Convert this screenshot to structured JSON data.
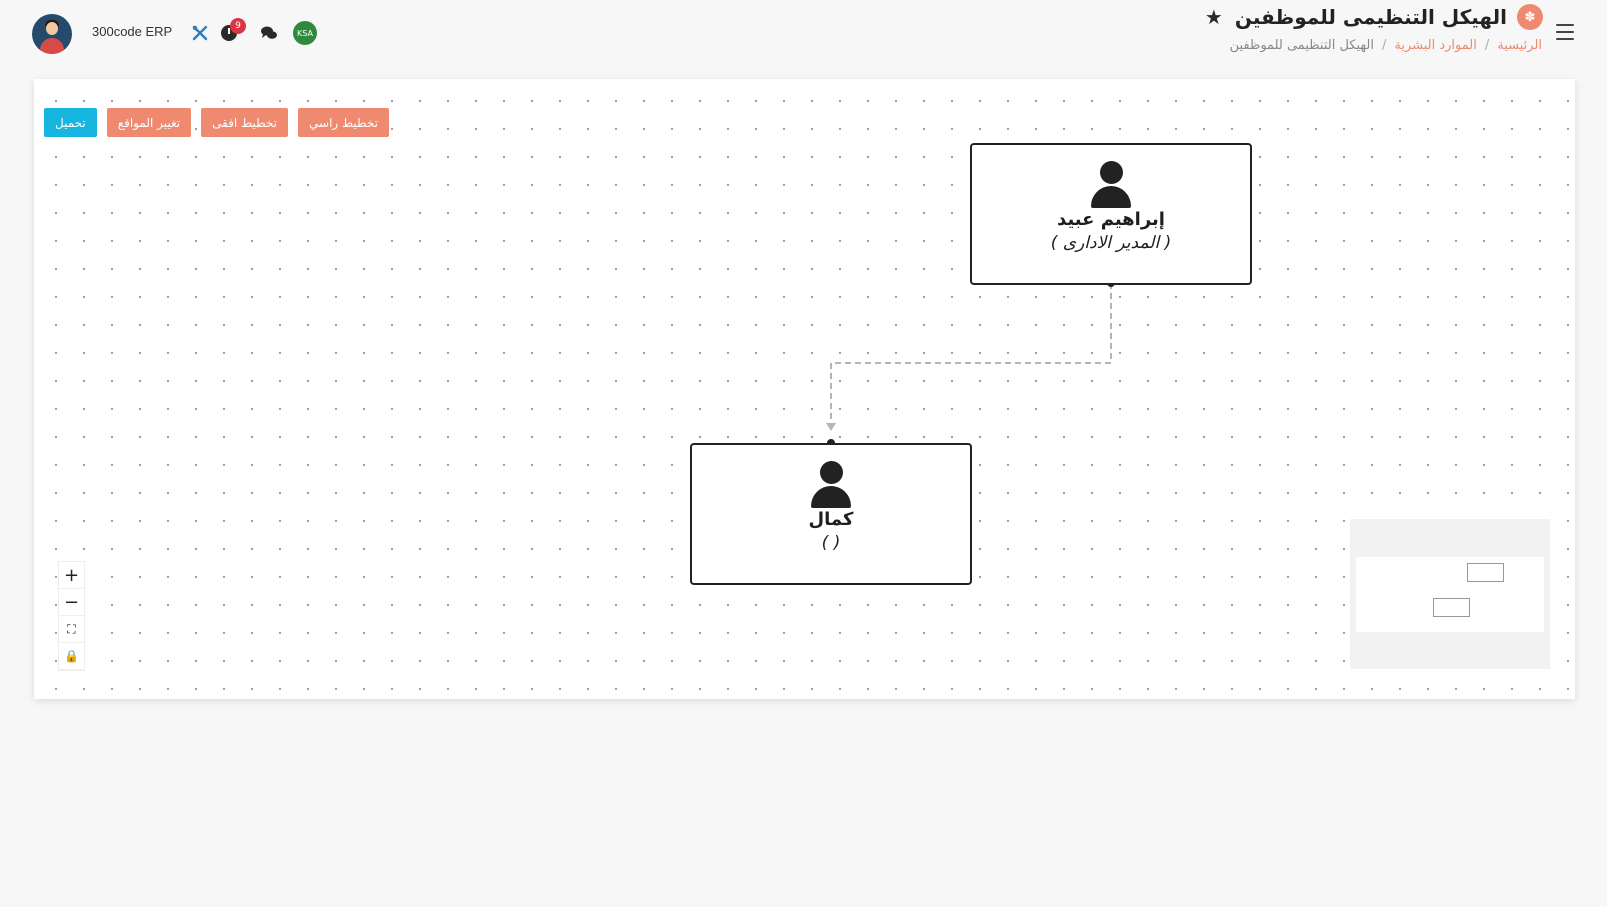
{
  "header": {
    "brand": "300code ERP",
    "notification_count": "9",
    "flag_label": "KSA",
    "page_title": "الهيكل التنظيمى للموظفين",
    "breadcrumb": {
      "home": "الرئيسية",
      "section": "الموارد البشرية",
      "current": "الهيكل التنظيمى للموظفين",
      "separator": "/"
    }
  },
  "toolbar": {
    "download_label": "تحميل",
    "change_positions_label": "تغيير المواقع",
    "horizontal_layout_label": "تخطيط افقى",
    "vertical_layout_label": "تخطيط راسي"
  },
  "nodes": [
    {
      "name": "إبراهيم عبيد",
      "role": "( المدير الادارى )"
    },
    {
      "name": "كمال",
      "role": "( )"
    }
  ],
  "zoom_controls": {
    "zoom_in": "+",
    "zoom_out": "−",
    "fit": "⛶",
    "lock": "🔒"
  },
  "colors": {
    "accent": "#ef8a70",
    "info": "#17b5e0",
    "danger": "#dc3545"
  }
}
